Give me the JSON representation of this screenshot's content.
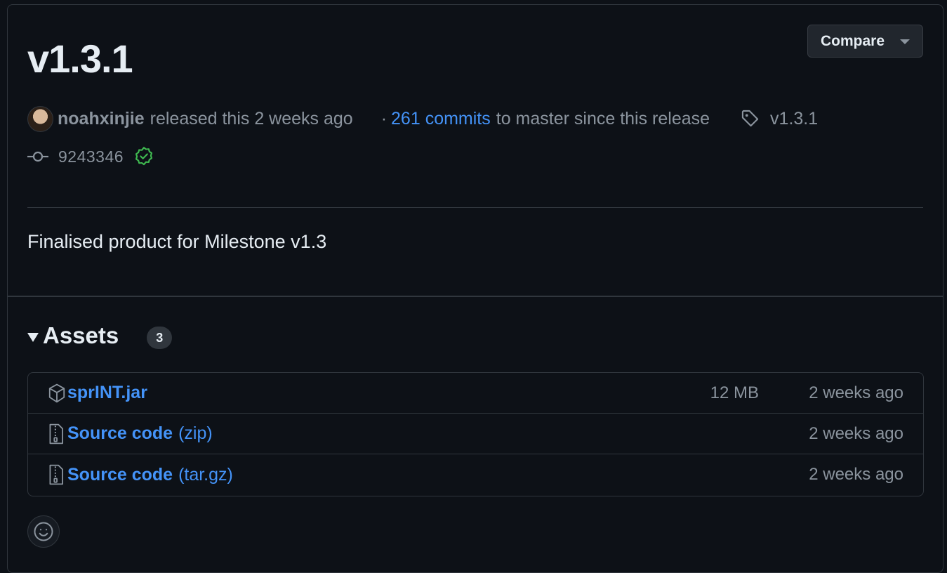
{
  "release": {
    "version": "v1.3.1",
    "compare_label": "Compare",
    "author": "noahxinjie",
    "released_text": "released this 2 weeks ago",
    "dot": "·",
    "commits_link": "261 commits",
    "commits_suffix": "to master since this release",
    "tag": "v1.3.1",
    "commit_sha": "9243346",
    "description": "Finalised product for Milestone v1.3"
  },
  "assets": {
    "title": "Assets",
    "count": "3",
    "items": [
      {
        "icon": "package-icon",
        "name": "sprINT.jar",
        "suffix": "",
        "size": "12 MB",
        "date": "2 weeks ago"
      },
      {
        "icon": "file-zip-icon",
        "name": "Source code",
        "suffix": "(zip)",
        "size": "",
        "date": "2 weeks ago"
      },
      {
        "icon": "file-zip-icon",
        "name": "Source code",
        "suffix": "(tar.gz)",
        "size": "",
        "date": "2 weeks ago"
      }
    ]
  },
  "colors": {
    "background": "#0d1117",
    "link": "#4493f8",
    "muted": "#8b949e",
    "verified": "#3fb950",
    "border": "#30363d"
  }
}
